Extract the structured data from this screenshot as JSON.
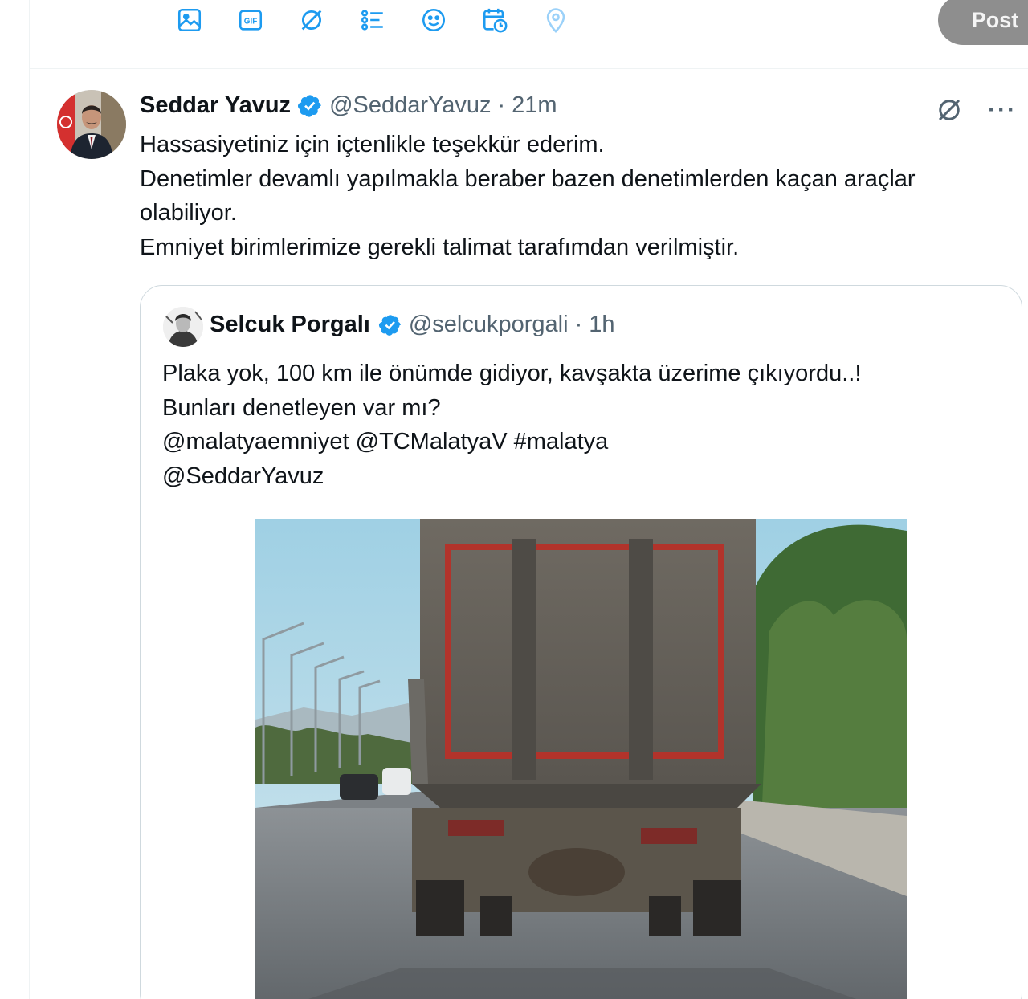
{
  "composer": {
    "tools": [
      {
        "icon": "image-icon",
        "label": "Media"
      },
      {
        "icon": "gif-icon",
        "label": "GIF"
      },
      {
        "icon": "grok-icon",
        "label": "Grok"
      },
      {
        "icon": "poll-icon",
        "label": "Poll"
      },
      {
        "icon": "emoji-icon",
        "label": "Emoji"
      },
      {
        "icon": "schedule-icon",
        "label": "Schedule"
      },
      {
        "icon": "location-icon",
        "label": "Location"
      }
    ],
    "gif_text": "GIF",
    "post_label": "Post",
    "accent_color": "#1d9bf0",
    "post_disabled_color": "#8e8e8e"
  },
  "tweet": {
    "author_name": "Seddar Yavuz",
    "handle": "@SeddarYavuz",
    "separator": "·",
    "time": "21m",
    "more": "···",
    "lines": [
      "Hassasiyetiniz için içtenlikle teşekkür ederim.",
      "Denetimler devamlı yapılmakla beraber bazen denetimlerden kaçan araçlar",
      "olabiliyor.",
      "Emniyet birimlerimize gerekli talimat tarafımdan verilmiştir."
    ],
    "verified_color": "#1d9bf0"
  },
  "quote": {
    "author_name": "Selcuk Porgalı",
    "handle": "@selcukporgali",
    "separator": "·",
    "time": "1h",
    "lines": [
      "Plaka yok, 100 km ile önümde gidiyor, kavşakta üzerime çıkıyordu..!",
      "Bunları denetleyen var mı?",
      "@malatyaemniyet @TCMalatyaV #malatya",
      "@SeddarYavuz"
    ]
  }
}
